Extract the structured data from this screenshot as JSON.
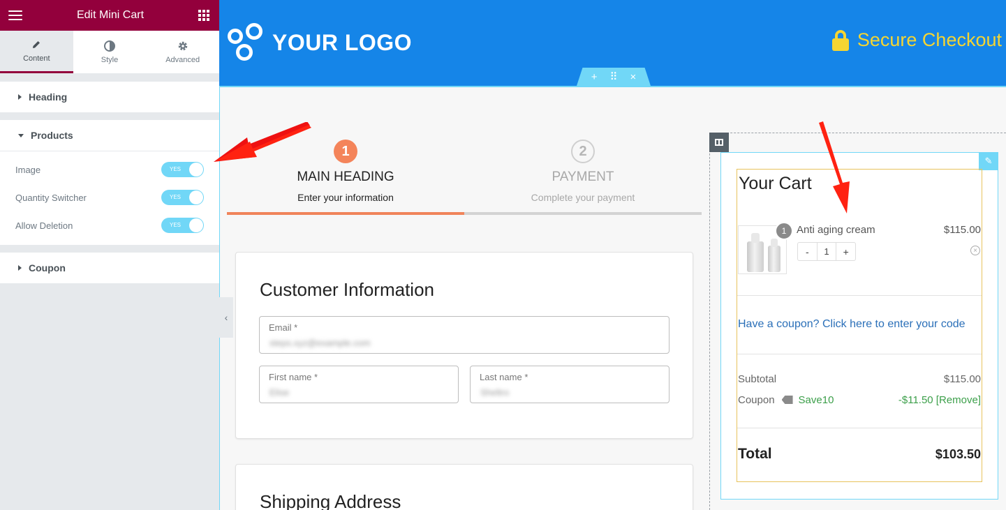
{
  "sidebar": {
    "title": "Edit Mini Cart",
    "tabs": [
      {
        "label": "Content",
        "icon": "pencil-icon"
      },
      {
        "label": "Style",
        "icon": "contrast-icon"
      },
      {
        "label": "Advanced",
        "icon": "gear-icon"
      }
    ],
    "sections": {
      "heading": "Heading",
      "products": "Products",
      "coupon": "Coupon"
    },
    "product_rows": [
      {
        "label": "Image",
        "toggle": "YES"
      },
      {
        "label": "Quantity Switcher",
        "toggle": "YES"
      },
      {
        "label": "Allow Deletion",
        "toggle": "YES"
      }
    ]
  },
  "header": {
    "logo_text": "YOUR LOGO",
    "secure_label": "Secure Checkout",
    "colors": {
      "background": "#1585e8",
      "secure": "#f5d532",
      "handle": "#71d7f7"
    },
    "section_handle": {
      "add": "+",
      "drag": "⠿",
      "close": "×"
    }
  },
  "steps": [
    {
      "number": "1",
      "title": "MAIN HEADING",
      "subtitle": "Enter your information"
    },
    {
      "number": "2",
      "title": "PAYMENT",
      "subtitle": "Complete your payment"
    }
  ],
  "customer_info": {
    "title": "Customer Information",
    "email_label": "Email *",
    "email_value": "steps.xyz@example.com",
    "first_name_label": "First name *",
    "first_name_value": "Elise",
    "last_name_label": "Last name *",
    "last_name_value": "Sheltro"
  },
  "shipping": {
    "title": "Shipping Address"
  },
  "cart": {
    "title": "Your Cart",
    "item": {
      "name": "Anti aging cream",
      "price": "$115.00",
      "qty": "1",
      "badge": "1",
      "minus": "-",
      "plus": "+"
    },
    "coupon_link": "Have a coupon? Click here to enter your code",
    "subtotal_label": "Subtotal",
    "subtotal_value": "$115.00",
    "coupon_label": "Coupon",
    "coupon_code": "Save10",
    "coupon_value": "-$11.50 [Remove]",
    "total_label": "Total",
    "total_value": "$103.50"
  },
  "colors": {
    "accent": "#93003c",
    "step_active": "#f4845a",
    "coupon_green": "#3c9f4a",
    "link": "#2a6fb8"
  }
}
